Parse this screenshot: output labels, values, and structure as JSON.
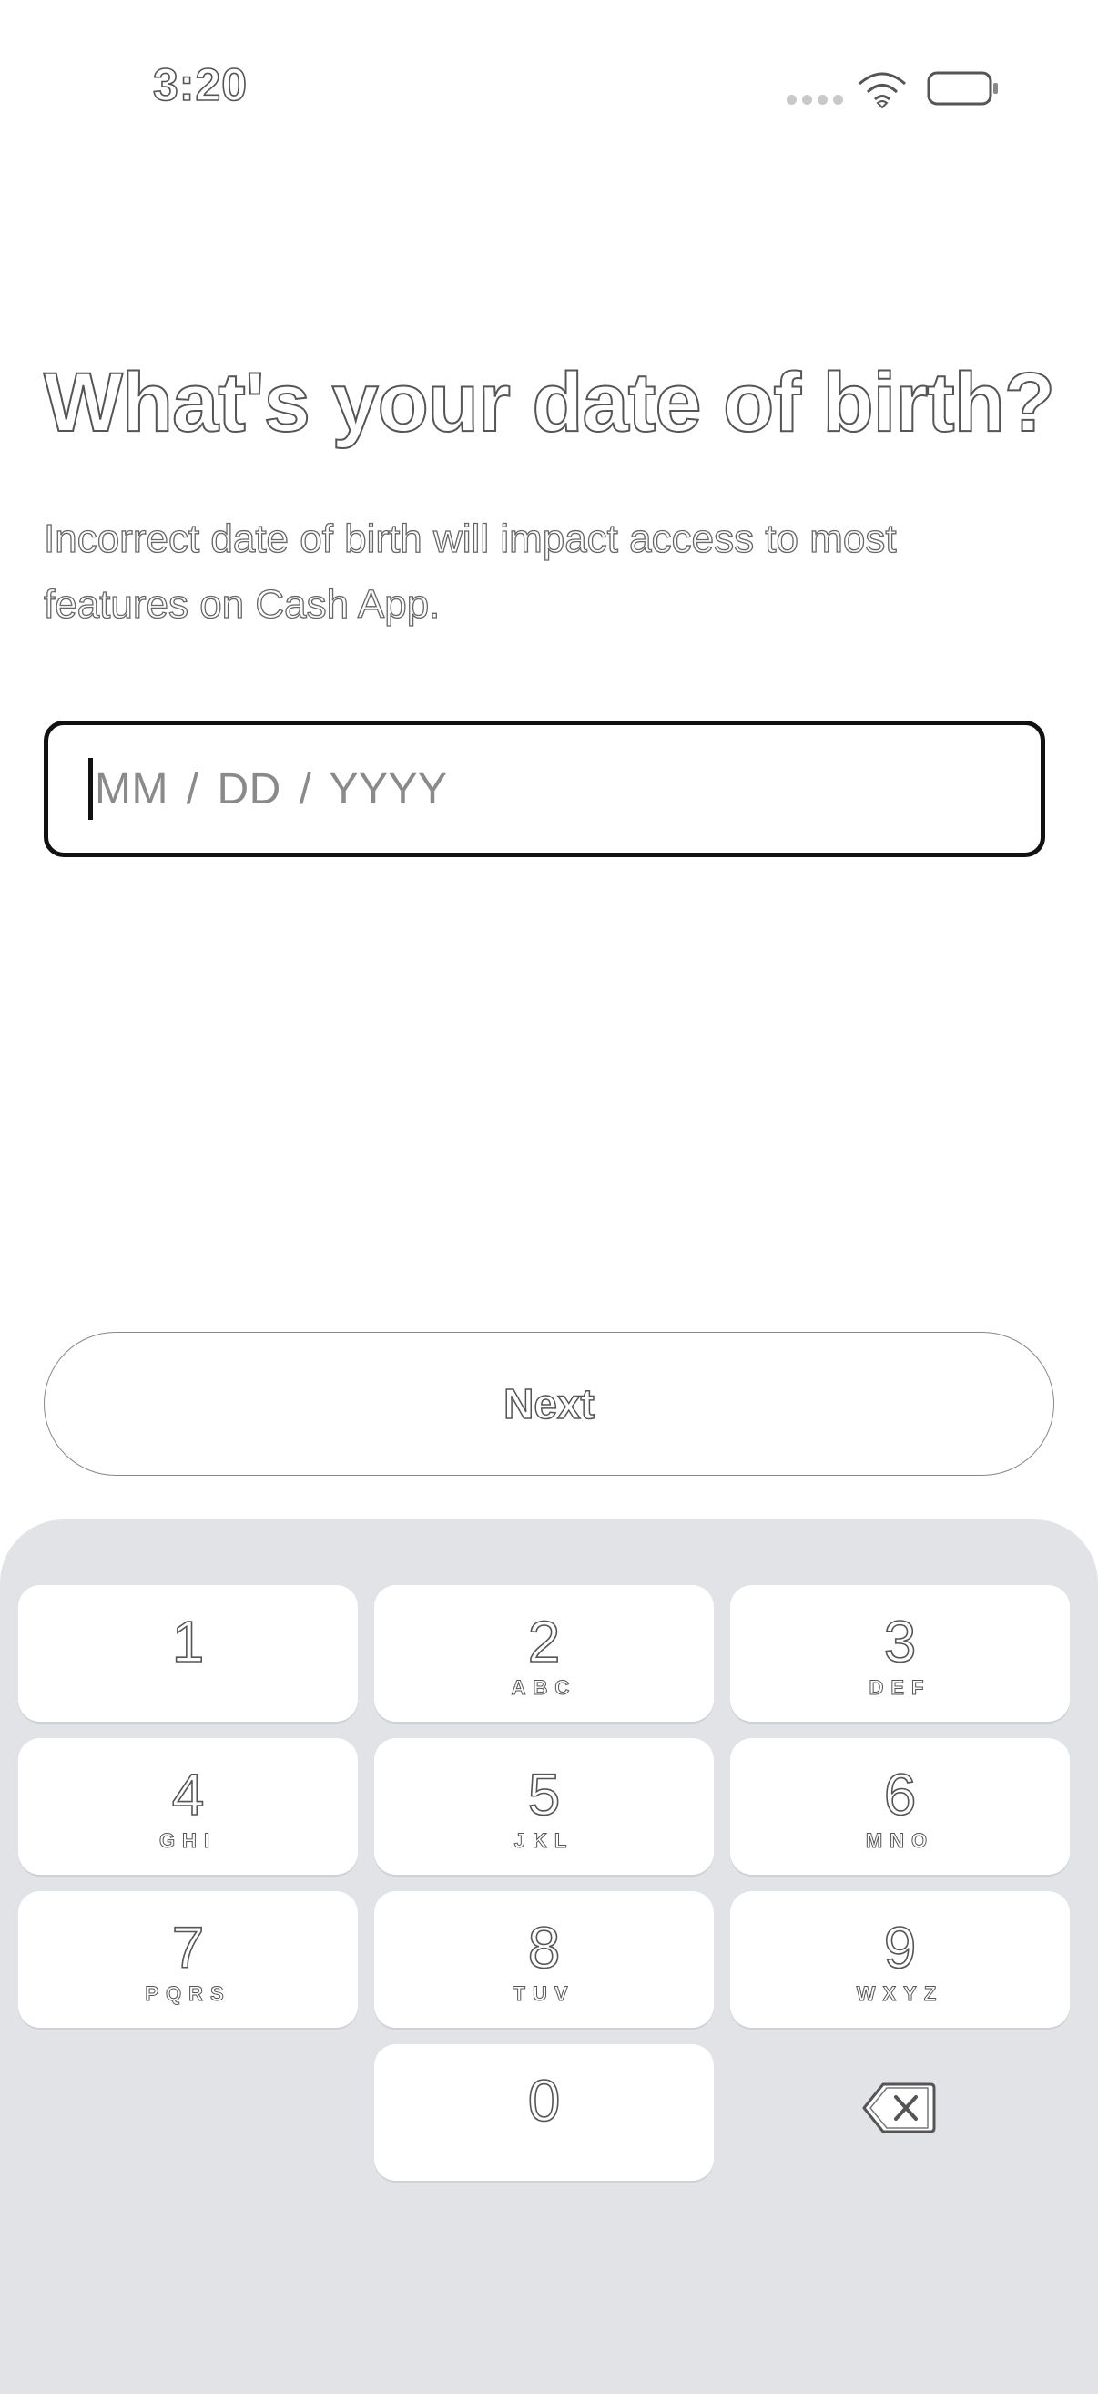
{
  "status_bar": {
    "time": "3:20"
  },
  "header": {
    "title": "What's your date of birth?",
    "subtitle": "Incorrect date of birth will impact access to most features on Cash App."
  },
  "dob_input": {
    "placeholder": "MM / DD / YYYY",
    "value": ""
  },
  "next_button": {
    "label": "Next"
  },
  "keypad": {
    "keys": [
      {
        "digit": "1",
        "letters": ""
      },
      {
        "digit": "2",
        "letters": "ABC"
      },
      {
        "digit": "3",
        "letters": "DEF"
      },
      {
        "digit": "4",
        "letters": "GHI"
      },
      {
        "digit": "5",
        "letters": "JKL"
      },
      {
        "digit": "6",
        "letters": "MNO"
      },
      {
        "digit": "7",
        "letters": "PQRS"
      },
      {
        "digit": "8",
        "letters": "TUV"
      },
      {
        "digit": "9",
        "letters": "WXYZ"
      },
      {
        "digit": "0",
        "letters": ""
      }
    ],
    "backspace_icon": "backspace-icon"
  },
  "colors": {
    "keypad_background": "#e2e3e7",
    "key_background": "#ffffff",
    "input_border": "#111111"
  }
}
